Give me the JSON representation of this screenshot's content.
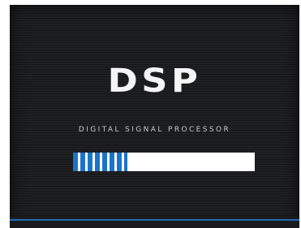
{
  "screen": {
    "logo": "DSP",
    "subtitle": "DIGITAL SIGNAL PROCESSOR"
  },
  "progress": {
    "value_percent": 30,
    "fill_color": "#1b73c9",
    "track_color": "#ffffff"
  },
  "theme": {
    "background": "#1c1c1e",
    "accent": "#1e6bb8"
  }
}
